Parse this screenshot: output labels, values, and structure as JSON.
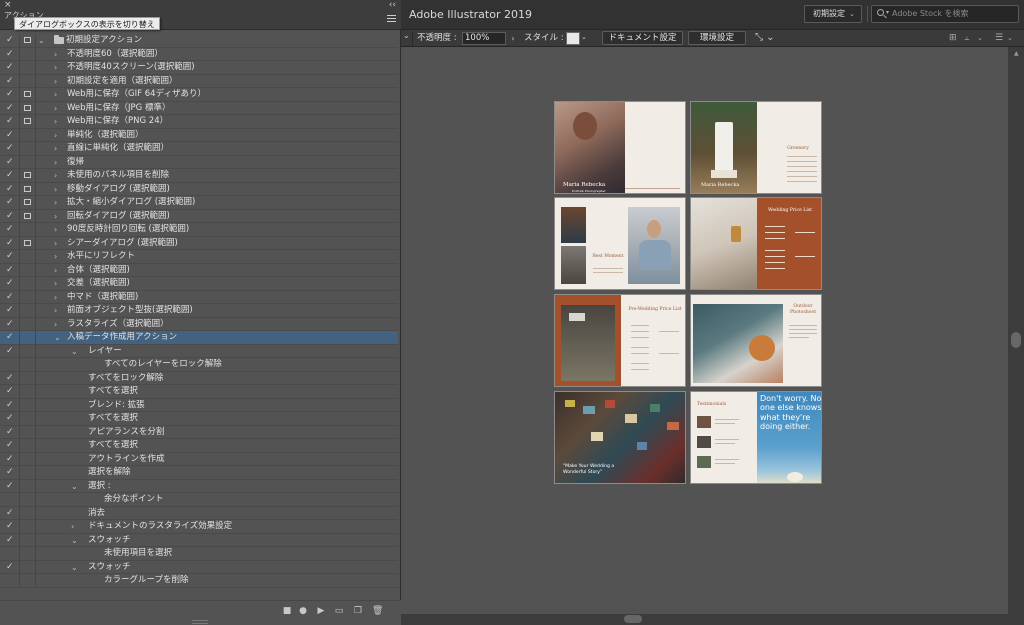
{
  "app": {
    "title": "Adobe Illustrator 2019"
  },
  "panel": {
    "tab_label": "アクション",
    "tooltip": "ダイアログボックスの表示を切り替え",
    "close_glyph": "×",
    "collapse_glyph": "‹‹",
    "rows": [
      {
        "label": "初期設定アクション",
        "indent": 1,
        "arrow": "⌄",
        "check": true,
        "dialog": true,
        "folder": true
      },
      {
        "label": "不透明度60（選択範囲）",
        "indent": 2,
        "arrow": "›",
        "check": true,
        "dialog": false
      },
      {
        "label": "不透明度40スクリーン(選択範囲)",
        "indent": 2,
        "arrow": "›",
        "check": true,
        "dialog": false
      },
      {
        "label": "初期設定を適用（選択範囲）",
        "indent": 2,
        "arrow": "›",
        "check": true,
        "dialog": false
      },
      {
        "label": "Web用に保存（GIF 64ディザあり）",
        "indent": 2,
        "arrow": "›",
        "check": true,
        "dialog": true
      },
      {
        "label": "Web用に保存（JPG 標準）",
        "indent": 2,
        "arrow": "›",
        "check": true,
        "dialog": true
      },
      {
        "label": "Web用に保存（PNG 24）",
        "indent": 2,
        "arrow": "›",
        "check": true,
        "dialog": true
      },
      {
        "label": "単純化（選択範囲）",
        "indent": 2,
        "arrow": "›",
        "check": true,
        "dialog": false
      },
      {
        "label": "直線に単純化（選択範囲）",
        "indent": 2,
        "arrow": "›",
        "check": true,
        "dialog": false
      },
      {
        "label": "復帰",
        "indent": 2,
        "arrow": "›",
        "check": true,
        "dialog": false
      },
      {
        "label": "未使用のパネル項目を削除",
        "indent": 2,
        "arrow": "›",
        "check": true,
        "dialog": true
      },
      {
        "label": "移動ダイアログ (選択範囲)",
        "indent": 2,
        "arrow": "›",
        "check": true,
        "dialog": true
      },
      {
        "label": "拡大・縮小ダイアログ (選択範囲)",
        "indent": 2,
        "arrow": "›",
        "check": true,
        "dialog": true
      },
      {
        "label": "回転ダイアログ (選択範囲)",
        "indent": 2,
        "arrow": "›",
        "check": true,
        "dialog": true
      },
      {
        "label": "90度反時計回り回転 (選択範囲)",
        "indent": 2,
        "arrow": "›",
        "check": true,
        "dialog": false
      },
      {
        "label": "シアーダイアログ (選択範囲)",
        "indent": 2,
        "arrow": "›",
        "check": true,
        "dialog": true
      },
      {
        "label": "水平にリフレクト",
        "indent": 2,
        "arrow": "›",
        "check": true,
        "dialog": false
      },
      {
        "label": "合体（選択範囲)",
        "indent": 2,
        "arrow": "›",
        "check": true,
        "dialog": false
      },
      {
        "label": "交差（選択範囲)",
        "indent": 2,
        "arrow": "›",
        "check": true,
        "dialog": false
      },
      {
        "label": "中マド（選択範囲)",
        "indent": 2,
        "arrow": "›",
        "check": true,
        "dialog": false
      },
      {
        "label": "前面オブジェクト型抜(選択範囲)",
        "indent": 2,
        "arrow": "›",
        "check": true,
        "dialog": false
      },
      {
        "label": "ラスタライズ（選択範囲）",
        "indent": 2,
        "arrow": "›",
        "check": true,
        "dialog": false
      },
      {
        "label": "入稿データ作成用アクション",
        "indent": 2,
        "arrow": "⌄",
        "check": true,
        "dialog": false,
        "selected": true
      },
      {
        "label": "レイヤー",
        "indent": 3,
        "arrow": "⌄",
        "check": true,
        "dialog": false
      },
      {
        "label": "すべてのレイヤーをロック解除",
        "indent": 4,
        "arrow": "",
        "check": false,
        "dialog": false
      },
      {
        "label": "すべてをロック解除",
        "indent": 3,
        "arrow": "",
        "check": true,
        "dialog": false
      },
      {
        "label": "すべてを選択",
        "indent": 3,
        "arrow": "",
        "check": true,
        "dialog": false
      },
      {
        "label": "ブレンド: 拡張",
        "indent": 3,
        "arrow": "",
        "check": true,
        "dialog": false
      },
      {
        "label": "すべてを選択",
        "indent": 3,
        "arrow": "",
        "check": true,
        "dialog": false
      },
      {
        "label": "アピアランスを分割",
        "indent": 3,
        "arrow": "",
        "check": true,
        "dialog": false
      },
      {
        "label": "すべてを選択",
        "indent": 3,
        "arrow": "",
        "check": true,
        "dialog": false
      },
      {
        "label": "アウトラインを作成",
        "indent": 3,
        "arrow": "",
        "check": true,
        "dialog": false
      },
      {
        "label": "選択を解除",
        "indent": 3,
        "arrow": "",
        "check": true,
        "dialog": false
      },
      {
        "label": "選択 :",
        "indent": 3,
        "arrow": "⌄",
        "check": true,
        "dialog": false
      },
      {
        "label": "余分なポイント",
        "indent": 4,
        "arrow": "",
        "check": false,
        "dialog": false
      },
      {
        "label": "消去",
        "indent": 3,
        "arrow": "",
        "check": true,
        "dialog": false
      },
      {
        "label": "ドキュメントのラスタライズ効果設定",
        "indent": 3,
        "arrow": "›",
        "check": true,
        "dialog": false
      },
      {
        "label": "スウォッチ",
        "indent": 3,
        "arrow": "⌄",
        "check": true,
        "dialog": false
      },
      {
        "label": "未使用項目を選択",
        "indent": 4,
        "arrow": "",
        "check": false,
        "dialog": false
      },
      {
        "label": "スウォッチ",
        "indent": 3,
        "arrow": "⌄",
        "check": true,
        "dialog": false
      },
      {
        "label": "カラーグループを削除",
        "indent": 4,
        "arrow": "",
        "check": false,
        "dialog": false
      }
    ],
    "bottom_buttons": [
      {
        "name": "stop-button",
        "glyph": "■"
      },
      {
        "name": "record-button",
        "glyph": "●"
      },
      {
        "name": "play-button",
        "glyph": "▶"
      },
      {
        "name": "new-set-button",
        "glyph": "▭"
      },
      {
        "name": "new-action-button",
        "glyph": "❐"
      },
      {
        "name": "delete-button",
        "glyph": "🗑"
      }
    ]
  },
  "topbar": {
    "workspace": "初期設定",
    "workspace_caret": "⌄",
    "stock_placeholder": "Adobe Stock を検索",
    "stock_caret": "▾"
  },
  "controlbar": {
    "left_glyph": "⌄",
    "opacity_label": "不透明度 :",
    "opacity_value": "100%",
    "opacity_arrow": "›",
    "style_label": "スタイル :",
    "style_caret": "⌄",
    "document_setup": "ドキュメント設定",
    "preferences": "環境設定",
    "arrange_glyph": "⤡ ⌄"
  },
  "artboards": {
    "p1": {
      "title": "Maria Rebecka",
      "sub": "Portrait Photographer"
    },
    "p2": {
      "title": "Greenery"
    },
    "p3": {
      "title": "Best Moment"
    },
    "p4": {
      "title": "Wedding Price List"
    },
    "p5": {
      "title": "Pre-Wedding Price List"
    },
    "p6": {
      "title": "Outdoor Photoshoot"
    },
    "p7": {
      "title": "\"Make Your Wedding a Wonderful Story\""
    },
    "p8": {
      "title": "Testimonials",
      "quote": "Don't worry. No one else knows what they're doing either."
    }
  }
}
